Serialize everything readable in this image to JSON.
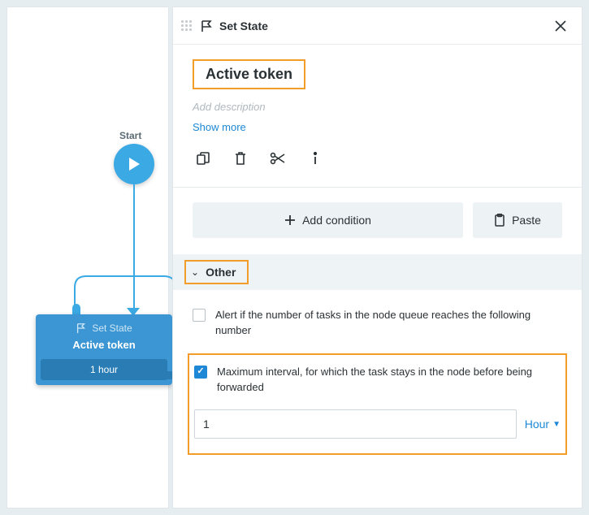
{
  "canvas": {
    "start_label": "Start",
    "node": {
      "type_label": "Set State",
      "title": "Active token",
      "badge": "1 hour"
    }
  },
  "panel": {
    "header_title": "Set State",
    "title": "Active token",
    "description_placeholder": "Add description",
    "show_more": "Show more",
    "add_condition": "Add condition",
    "paste": "Paste",
    "section_other": "Other",
    "option_alert": "Alert if the number of tasks in the node queue reaches the following number",
    "option_interval": "Maximum interval, for which the task stays in the node before being forwarded",
    "interval_value": "1",
    "interval_unit": "Hour"
  }
}
